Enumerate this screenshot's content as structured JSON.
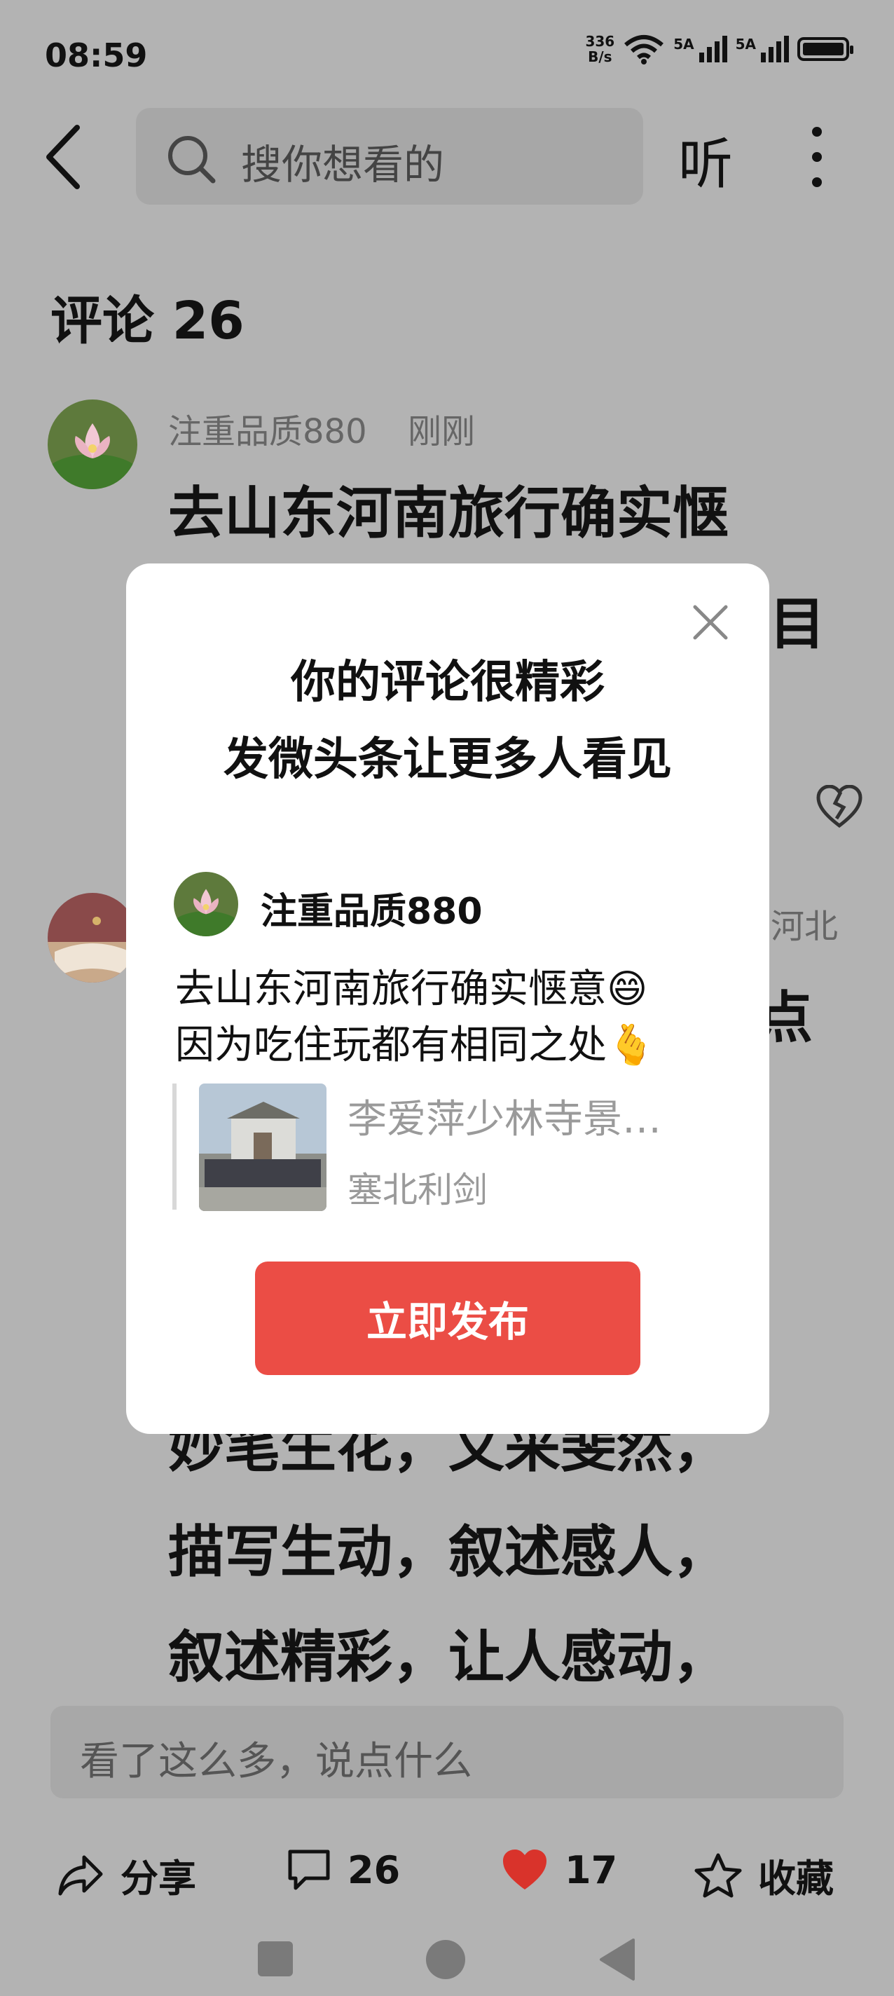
{
  "status": {
    "time": "08:59",
    "net_speed_value": "336",
    "net_speed_unit": "B/s",
    "sim1": "5A",
    "sim2": "5A"
  },
  "nav": {
    "search_placeholder": "搜你想看的",
    "listen_label": "听"
  },
  "comments": {
    "title": "评论 26",
    "first": {
      "user": "注重品质880",
      "time": "刚刚",
      "line1": "去山东河南旅行确实惬",
      "tail_line2": "目"
    },
    "second": {
      "location_tail": "河北",
      "tail_line1": "点"
    },
    "text_lines": [
      "妙笔生花，文采斐然，",
      "描写生动，叙述感人，",
      "叙述精彩，让人感动，"
    ],
    "input_placeholder": "看了这么多，说点什么"
  },
  "actions": {
    "share": "分享",
    "comment_count": "26",
    "like_count": "17",
    "favorite": "收藏"
  },
  "modal": {
    "title_line1": "你的评论很精彩",
    "title_line2": "发微头条让更多人看见",
    "user": "注重品质880",
    "body_line1": "去山东河南旅行确实惬意😄",
    "body_line2": "因为吃住玩都有相同之处🫰",
    "quote_title": "李爱萍少林寺景…",
    "quote_author": "塞北利剑",
    "publish_label": "立即发布"
  },
  "colors": {
    "accent": "#eb4d45",
    "heart": "#d9332b",
    "overlay_bg": "#b3b3b3"
  }
}
